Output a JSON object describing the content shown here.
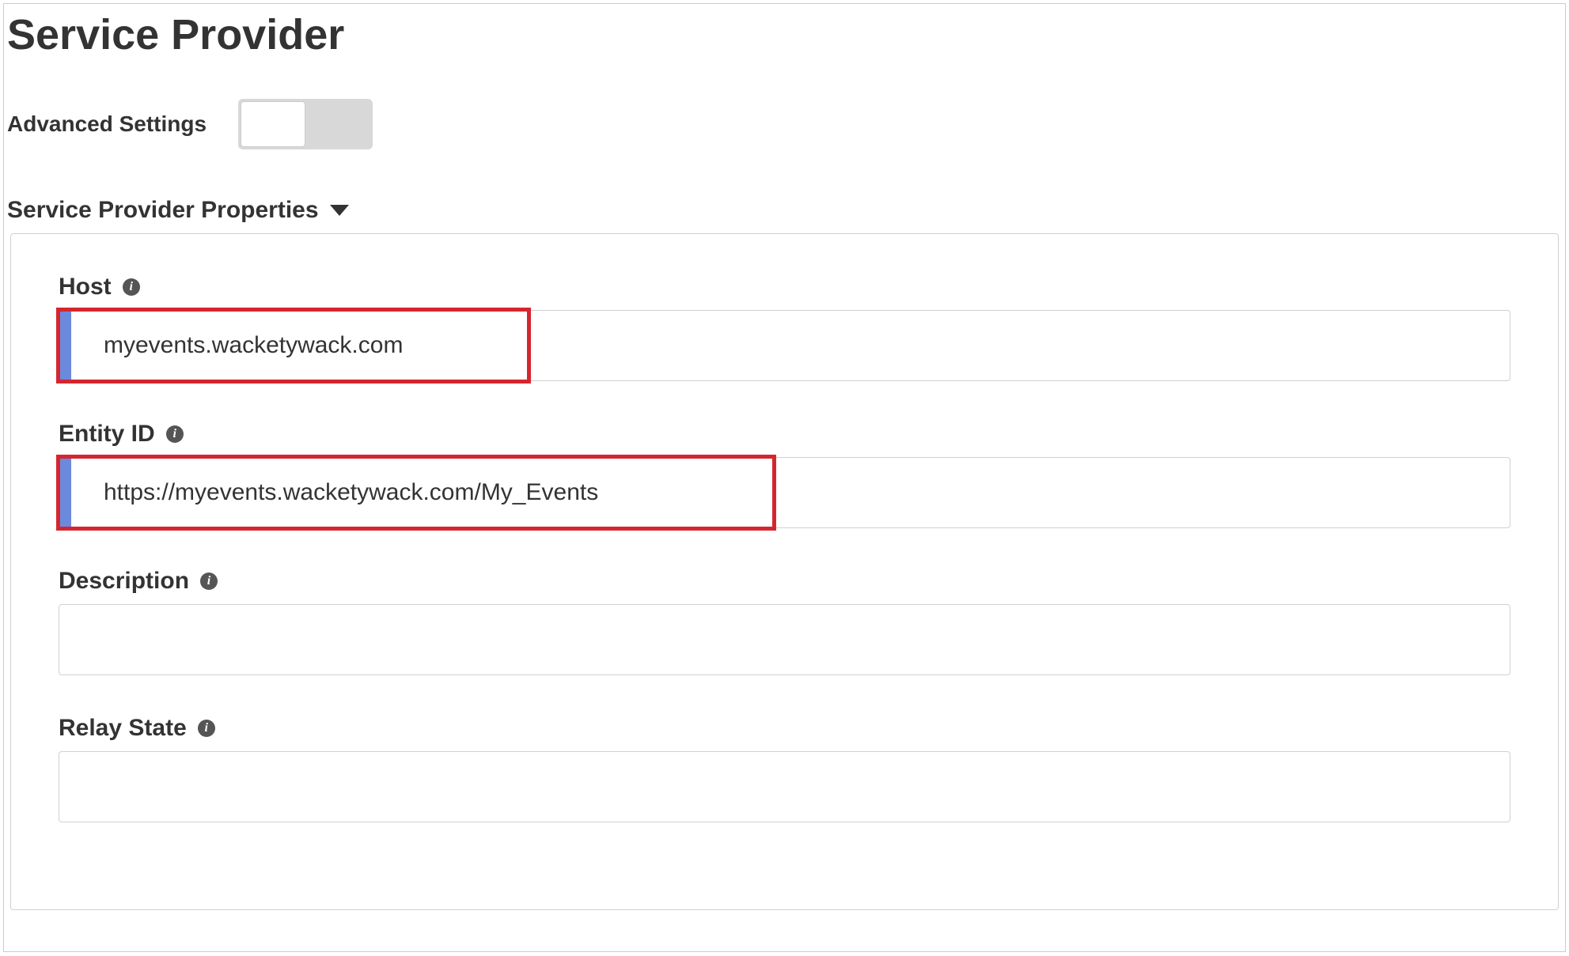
{
  "page": {
    "title": "Service Provider"
  },
  "advanced": {
    "label": "Advanced Settings",
    "enabled": false
  },
  "section": {
    "title": "Service Provider Properties"
  },
  "fields": {
    "host": {
      "label": "Host",
      "value": "myevents.wacketywack.com"
    },
    "entity_id": {
      "label": "Entity ID",
      "value": "https://myevents.wacketywack.com/My_Events"
    },
    "description": {
      "label": "Description",
      "value": ""
    },
    "relay_state": {
      "label": "Relay State",
      "value": ""
    }
  },
  "icons": {
    "info_glyph": "i"
  }
}
